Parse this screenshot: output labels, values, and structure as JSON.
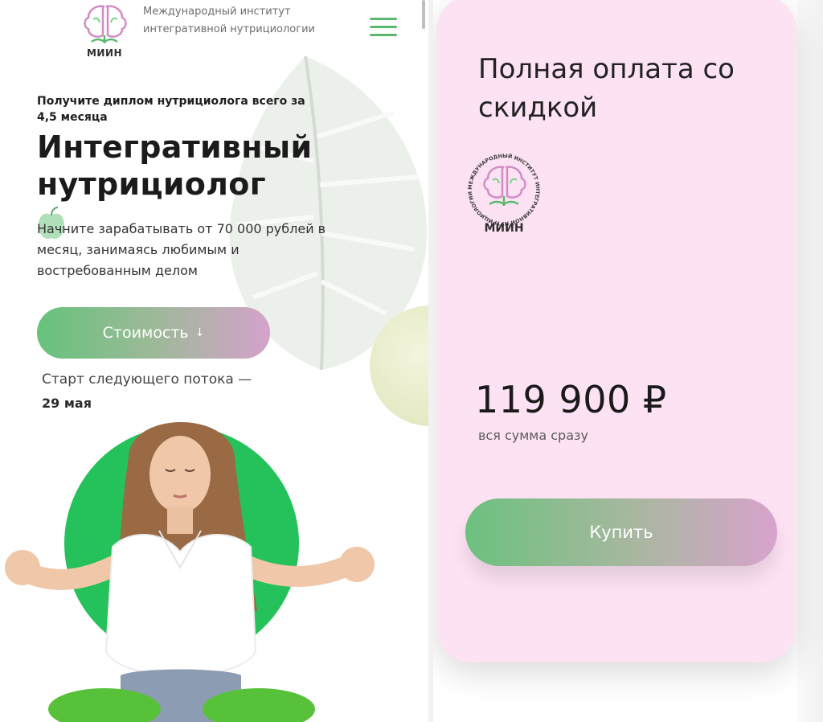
{
  "header": {
    "logo_text": "МИИН",
    "org_name": "Международный институт интегративной нутрициологии",
    "menu_icon": "hamburger-menu-icon"
  },
  "hero": {
    "subtitle": "Получите диплом нутрициолога всего за 4,5 месяца",
    "title": "Интегративный нутрициолог",
    "description": "Начните зарабатывать от 70 000 рублей в месяц, занимаясь любимым и востребованным делом",
    "cost_button": "Стоимость",
    "cost_arrow": "↓",
    "start_label": "Старт следующего потока —",
    "start_date": "29 мая"
  },
  "pricing_card": {
    "title": "Полная оплата со скидкой",
    "logo_text": "МИИН",
    "logo_ring_text": "МЕЖДУНАРОДНЫЙ ИНСТИТУТ ИНТЕГРАТИВНОЙ НУТРИЦИОЛОГИИ",
    "price": "119 900 ₽",
    "price_note": "вся сумма сразу",
    "buy_button": "Купить"
  },
  "colors": {
    "accent_green": "#58b86c",
    "accent_pink": "#d5a2cc",
    "card_background": "#fde2f4",
    "hero_circle": "#25c15a"
  }
}
